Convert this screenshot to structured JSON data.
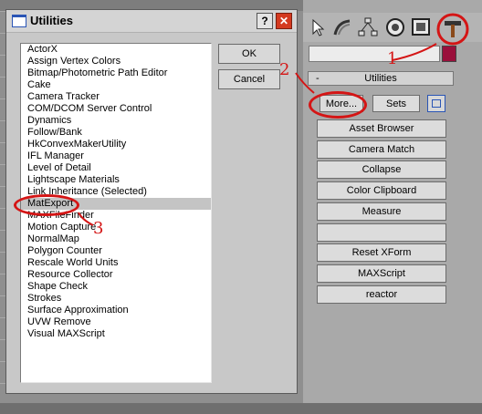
{
  "dialog": {
    "title": "Utilities",
    "help_label": "?",
    "close_label": "✕",
    "ok_label": "OK",
    "cancel_label": "Cancel",
    "items": [
      "ActorX",
      "Assign Vertex Colors",
      "Bitmap/Photometric Path Editor",
      "Cake",
      "Camera Tracker",
      "COM/DCOM Server Control",
      "Dynamics",
      "Follow/Bank",
      "HkConvexMakerUtility",
      "IFL Manager",
      "Level of Detail",
      "Lightscape Materials",
      "Link Inheritance (Selected)",
      "MatExport",
      "MAXFileFinder",
      "Motion Capture",
      "NormalMap",
      "Polygon Counter",
      "Rescale World Units",
      "Resource Collector",
      "Shape Check",
      "Strokes",
      "Surface Approximation",
      "UVW Remove",
      "Visual MAXScript"
    ],
    "selected_item": "MatExport"
  },
  "panel": {
    "rollout_minus": "-",
    "rollout_title": "Utilities",
    "more_label": "More...",
    "sets_label": "Sets",
    "buttons": [
      "Asset Browser",
      "Camera Match",
      "Collapse",
      "Color Clipboard",
      "Measure",
      "",
      "Reset XForm",
      "MAXScript",
      "reactor"
    ],
    "swatch_color": "#9a0f3b"
  },
  "annotations": {
    "step1": "1",
    "step2": "2",
    "step3": "3",
    "color": "#d41515"
  },
  "icons": {
    "titlebar": "window-icon",
    "tools": [
      "select-arrow-icon",
      "curve-icon",
      "hierarchy-icon",
      "motion-icon",
      "display-icon",
      "hammer-icon"
    ]
  }
}
